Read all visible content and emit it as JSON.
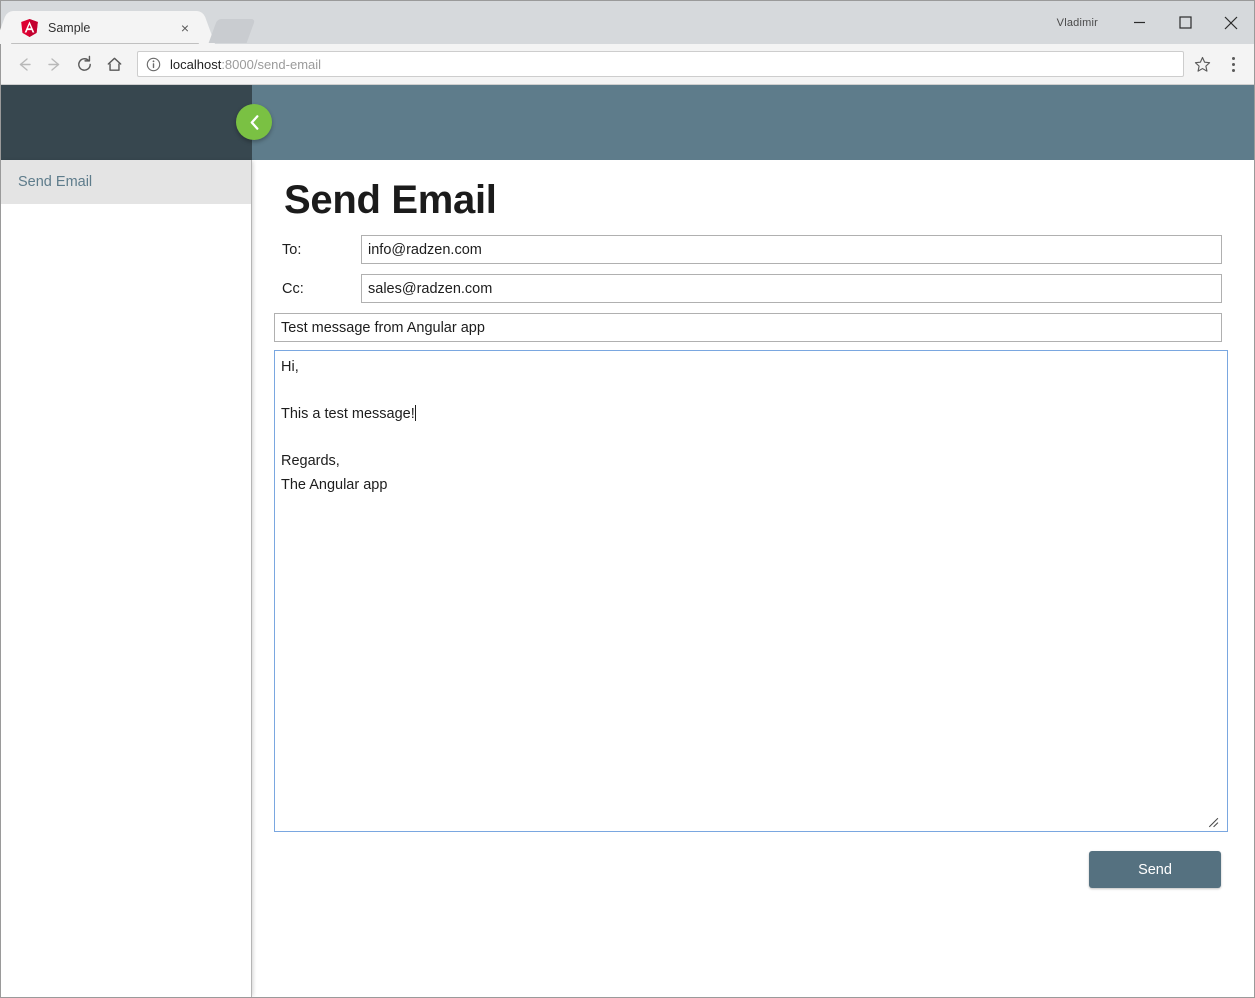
{
  "browser": {
    "tab": {
      "title": "Sample",
      "favicon": "angular-logo-icon",
      "close_label": "×"
    },
    "new_tab_label": "",
    "window": {
      "user": "Vladimir",
      "minimize_label": "—",
      "maximize_label": "☐",
      "close_label": "✕"
    },
    "toolbar": {
      "back_icon": "back-arrow-icon",
      "forward_icon": "forward-arrow-icon",
      "reload_icon": "reload-icon",
      "home_icon": "home-icon",
      "info_icon": "site-info-icon",
      "bookmark_icon": "star-icon",
      "menu_icon": "three-dot-menu-icon"
    },
    "address": {
      "host": "localhost",
      "path": ":8000/send-email",
      "full_url": "localhost:8000/send-email"
    }
  },
  "app": {
    "header": {
      "brand_color": "#37474f",
      "bar_color": "#5e7c8b",
      "toggle": {
        "icon": "chevron-left-icon",
        "color": "#7ac143"
      }
    },
    "sidebar": {
      "items": [
        {
          "label": "Send Email",
          "selected": true
        }
      ]
    },
    "page": {
      "title": "Send Email",
      "fields": [
        {
          "label": "To:",
          "value": "info@radzen.com",
          "name": "to"
        },
        {
          "label": "Cc:",
          "value": "sales@radzen.com",
          "name": "cc"
        }
      ],
      "subject": {
        "value": "Test message from Angular app",
        "placeholder": ""
      },
      "body": {
        "value": "Hi,\n\nThis a test message!",
        "value_tail": "\n\nRegards,\nThe Angular app",
        "full_value": "Hi,\n\nThis a test message!\n\nRegards,\nThe Angular app",
        "has_caret": true
      },
      "send_button": {
        "label": "Send",
        "color": "#557180"
      }
    }
  }
}
